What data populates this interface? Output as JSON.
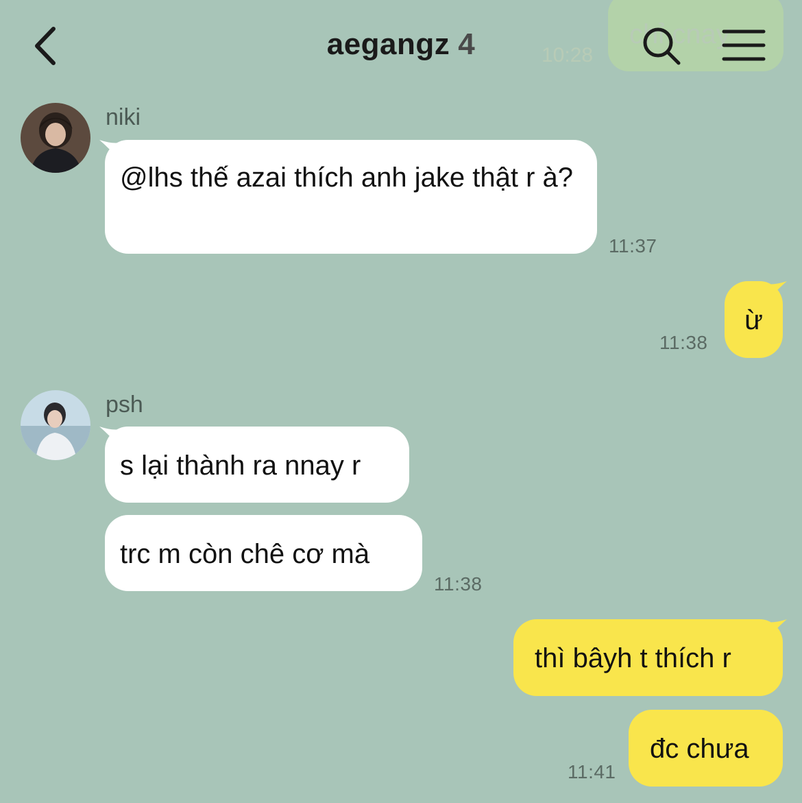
{
  "header": {
    "title": "aegangz",
    "member_count": "4",
    "background_preview_text": "chỉ cnay",
    "background_preview_time": "10:28"
  },
  "messages": [
    {
      "sender": "niki",
      "text": "@lhs thế azai thích anh jake thật r à?",
      "time": "11:37",
      "side": "left"
    },
    {
      "sender": "me",
      "text": "ừ",
      "time": "11:38",
      "side": "right"
    },
    {
      "sender": "psh",
      "text": "s lại thành ra nnay r",
      "time": "",
      "side": "left"
    },
    {
      "sender": "psh",
      "text": "trc m còn chê cơ mà",
      "time": "11:38",
      "side": "left"
    },
    {
      "sender": "me",
      "text": "thì bâyh t thích r",
      "time": "",
      "side": "right"
    },
    {
      "sender": "me",
      "text": "đc chưa",
      "time": "11:41",
      "side": "right"
    }
  ],
  "colors": {
    "background": "#a8c5b8",
    "incoming_bubble": "#ffffff",
    "outgoing_bubble": "#f9e54c"
  },
  "icons": [
    "back-arrow-icon",
    "search-icon",
    "menu-icon"
  ]
}
